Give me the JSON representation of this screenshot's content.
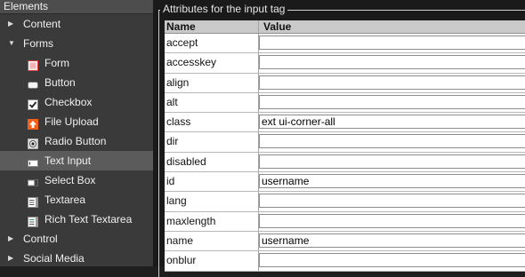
{
  "sidebar": {
    "title": "Elements",
    "items": [
      {
        "label": "Content",
        "expanded": false
      },
      {
        "label": "Forms",
        "expanded": true
      },
      {
        "label": "Form",
        "icon": "form-icon"
      },
      {
        "label": "Button",
        "icon": "button-icon"
      },
      {
        "label": "Checkbox",
        "icon": "checkbox-icon"
      },
      {
        "label": "File Upload",
        "icon": "file-upload-icon"
      },
      {
        "label": "Radio Button",
        "icon": "radio-button-icon"
      },
      {
        "label": "Text Input",
        "icon": "text-input-icon",
        "selected": true
      },
      {
        "label": "Select Box",
        "icon": "select-box-icon"
      },
      {
        "label": "Textarea",
        "icon": "textarea-icon"
      },
      {
        "label": "Rich Text Textarea",
        "icon": "rich-text-icon"
      },
      {
        "label": "Control",
        "expanded": false
      },
      {
        "label": "Social Media",
        "expanded": false
      }
    ]
  },
  "attributes": {
    "legend": "Attributes for the input tag",
    "col_name": "Name",
    "col_value": "Value",
    "rows": [
      {
        "name": "accept",
        "value": ""
      },
      {
        "name": "accesskey",
        "value": ""
      },
      {
        "name": "align",
        "value": ""
      },
      {
        "name": "alt",
        "value": ""
      },
      {
        "name": "class",
        "value": "ext ui-corner-all"
      },
      {
        "name": "dir",
        "value": ""
      },
      {
        "name": "disabled",
        "value": ""
      },
      {
        "name": "id",
        "value": "username"
      },
      {
        "name": "lang",
        "value": ""
      },
      {
        "name": "maxlength",
        "value": ""
      },
      {
        "name": "name",
        "value": "username"
      },
      {
        "name": "onblur",
        "value": ""
      }
    ]
  },
  "colors": {
    "sidebar_bg": "#3a3a3a",
    "selected_bg": "#5b5b5b",
    "grid_header": "#c9c9c9"
  }
}
